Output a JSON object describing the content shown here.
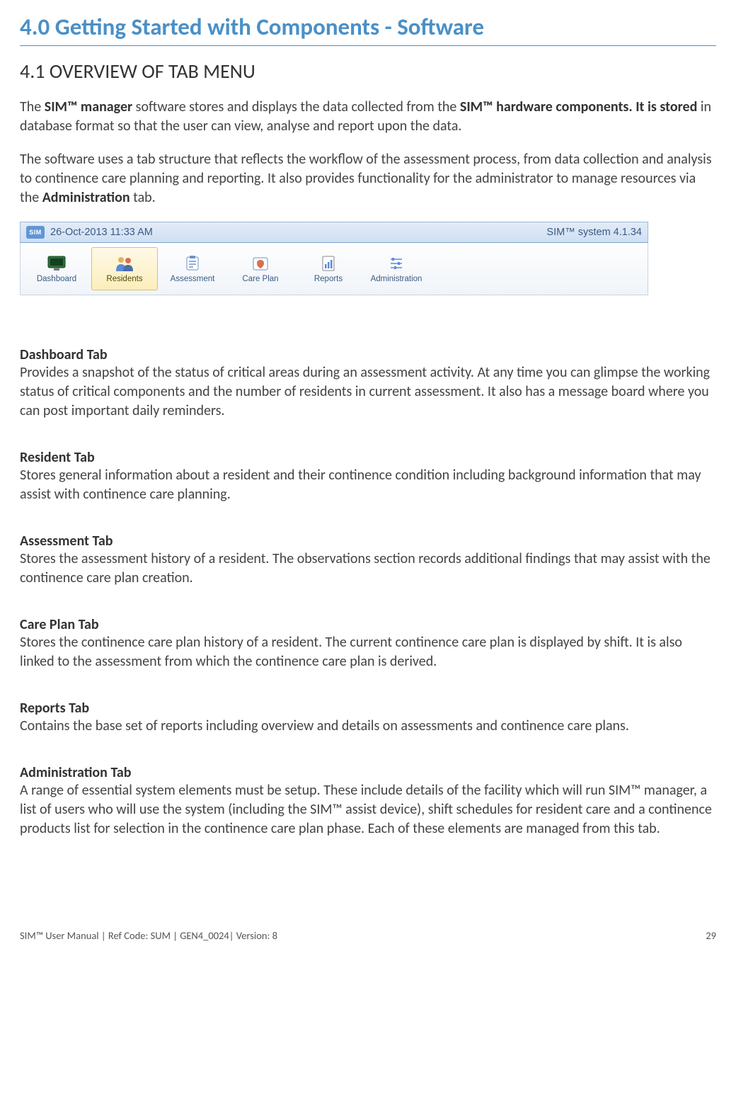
{
  "heading": "4.0 Getting Started with Components - Software",
  "subheading": "4.1 OVERVIEW OF TAB MENU",
  "intro1_pre": "The ",
  "intro1_b1": "SIM™  manager",
  "intro1_mid": " software stores and displays the data collected from the ",
  "intro1_b2": "SIM™ hardware components. It is stored",
  "intro1_post": " in database format so that the user can view, analyse and report upon the data.",
  "intro2_pre": "The software uses a tab structure that reflects the workflow of the assessment process, from data collection and analysis to continence care planning and reporting. It also provides functionality for the administrator to manage resources via the ",
  "intro2_b": "Administration",
  "intro2_post": " tab.",
  "screenshot": {
    "sim_chip": "SIM",
    "datetime": "26-Oct-2013 11:33 AM",
    "version": "SIM™ system 4.1.34",
    "tabs": [
      {
        "label": "Dashboard"
      },
      {
        "label": "Residents"
      },
      {
        "label": "Assessment"
      },
      {
        "label": "Care Plan"
      },
      {
        "label": "Reports"
      },
      {
        "label": "Administration"
      }
    ]
  },
  "sections": [
    {
      "label": "Dashboard Tab",
      "desc": "Provides a snapshot of the status of critical areas during an assessment activity. At any time you can glimpse the working status of critical components and the number of residents in current assessment. It also has a message board where you can post important daily reminders."
    },
    {
      "label": "Resident Tab",
      "desc": "Stores general information about a resident and their continence condition including background information that may assist with continence care planning."
    },
    {
      "label": "Assessment Tab",
      "desc": "Stores the assessment history of a resident. The observations section records additional findings that may assist with the continence care plan creation."
    },
    {
      "label": "Care Plan Tab",
      "desc": "Stores the continence care plan history of a resident. The current continence care plan is displayed by shift. It is also linked to the assessment from which the continence care plan is derived."
    },
    {
      "label": "Reports Tab",
      "desc": "Contains the base set of reports including overview and details on assessments and continence care plans."
    },
    {
      "label": "Administration Tab",
      "desc": "A range of essential system elements must be setup. These include details of the facility which will run SIM™ manager, a list of users who will use the system (including the SIM™ assist device), shift schedules for resident care and a continence products list for selection in the continence care plan phase. Each of these elements are managed from this tab."
    }
  ],
  "footer_left": "SIM™ User Manual | Ref Code: SUM | GEN4_0024| Version: 8",
  "footer_right": "29"
}
